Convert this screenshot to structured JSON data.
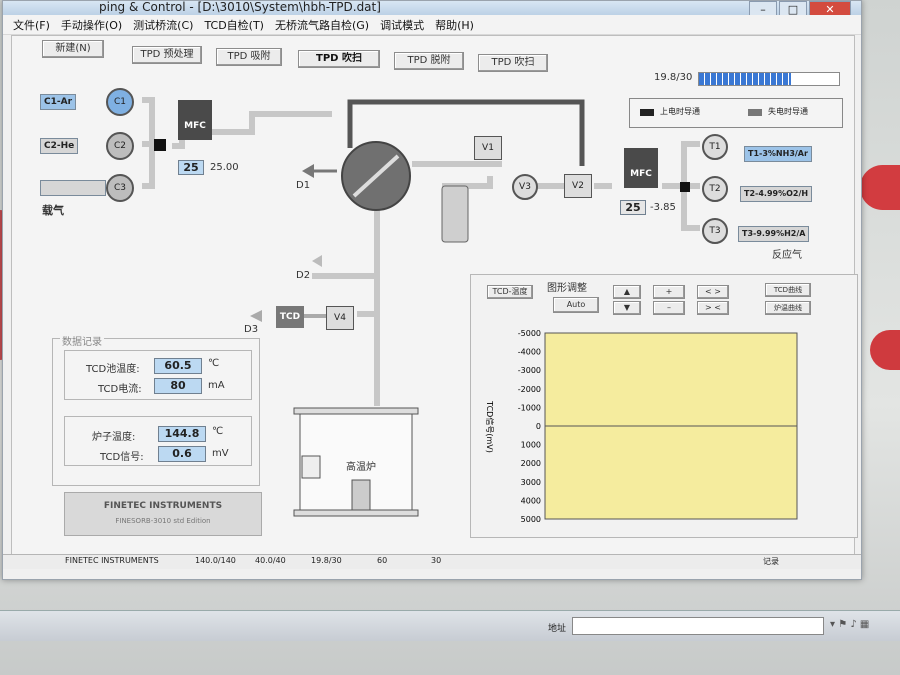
{
  "window": {
    "title": "D:\\3010\\System\\hbh-TPD.dat]",
    "title_prefix": "ping & Control - ["
  },
  "menu": [
    "文件(F)",
    "手动操作(O)",
    "测试桥流(C)",
    "TCD自检(T)",
    "无桥流气路自检(G)",
    "调试模式",
    "帮助(H)"
  ],
  "toolbar": {
    "new_label": "新建(N)",
    "tabs": [
      "TPD 预处理",
      "TPD 吸附",
      "TPD 吹扫",
      "TPD 脱附",
      "TPD 吹扫"
    ],
    "active_index": 2
  },
  "progress": {
    "text": "19.8/30",
    "fraction": 0.66
  },
  "legend": {
    "on_label": "上电时导通",
    "off_label": "失电时导通"
  },
  "inputs": {
    "gases": [
      {
        "label": "C1-Ar",
        "circle": "C1"
      },
      {
        "label": "C2-He",
        "circle": "C2"
      },
      {
        "label": "",
        "circle": "C3"
      }
    ],
    "carrier_label": "载气"
  },
  "mfc1": {
    "label": "MFC",
    "set": "25",
    "actual": "25.00"
  },
  "mfc2": {
    "label": "MFC",
    "set": "25",
    "actual": "-3.85"
  },
  "valves": {
    "v1": "V1",
    "v2": "V2",
    "v3": "V3",
    "v4": "V4"
  },
  "outputs": {
    "d1": "D1",
    "d2": "D2",
    "d3": "D3",
    "tcd": "TCD"
  },
  "reactive": {
    "gases": [
      {
        "circle": "T1",
        "label": "T1-3%NH3/Ar"
      },
      {
        "circle": "T2",
        "label": "T2-4.99%O2/H"
      },
      {
        "circle": "T3",
        "label": "T3-9.99%H2/A"
      }
    ],
    "label": "反应气"
  },
  "furnace": {
    "label": "高温炉"
  },
  "data_record": {
    "title": "数据记录",
    "rows1": [
      {
        "label": "TCD池温度:",
        "value": "60.5",
        "unit": "℃"
      },
      {
        "label": "TCD电流:",
        "value": "80",
        "unit": "mA"
      }
    ],
    "rows2": [
      {
        "label": "炉子温度:",
        "value": "144.8",
        "unit": "℃"
      },
      {
        "label": "TCD信号:",
        "value": "0.6",
        "unit": "mV"
      }
    ]
  },
  "brand": {
    "line1": "FINETEC INSTRUMENTS",
    "line2": "FINESORB-3010",
    "edition": "Edition",
    "ord": "std"
  },
  "chart_controls": {
    "tcd_temp": "TCD-温度",
    "adjust": "图形调整",
    "auto": "Auto",
    "up": "▲",
    "down": "▼",
    "plus": "+",
    "minus": "–",
    "wide": "< >",
    "narrow": "> <",
    "tcd_curve": "TCD曲线",
    "furnace_curve": "炉温曲线"
  },
  "chart_data": {
    "type": "line",
    "ylabel": "TCD信号(mV)",
    "yticks": [
      "-5000",
      "-4000",
      "-3000",
      "-2000",
      "-1000",
      "0",
      "1000",
      "2000",
      "3000",
      "4000",
      "5000"
    ],
    "ylim": [
      -5000,
      5000
    ],
    "series": [
      {
        "values": [
          0,
          0
        ]
      }
    ]
  },
  "status": {
    "cells": [
      "FINETEC INSTRUMENTS",
      "140.0/140",
      "40.0/40",
      "19.8/30",
      "60",
      "30"
    ],
    "right": "记录"
  },
  "taskbar": {
    "address_label": "地址"
  }
}
